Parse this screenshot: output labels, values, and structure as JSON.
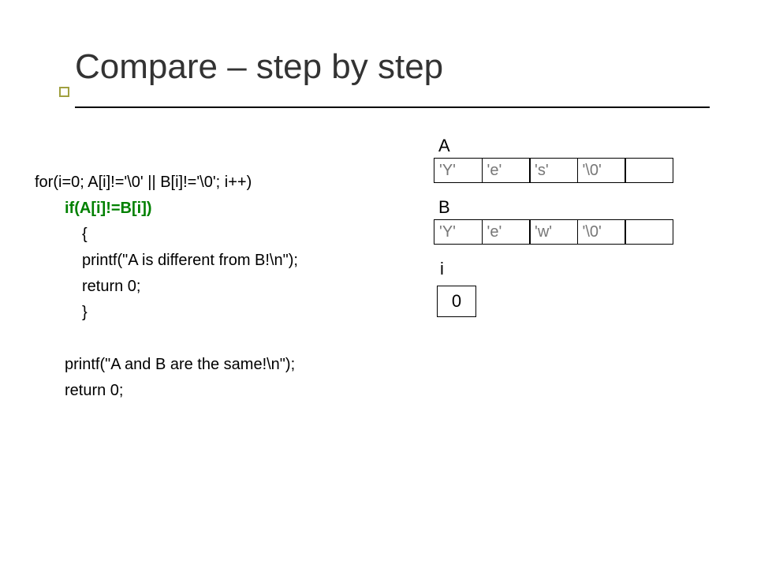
{
  "title": "Compare – step by step",
  "code": {
    "l1": "for(i=0; A[i]!='\\0' || B[i]!='\\0'; i++)",
    "l2": "if(A[i]!=B[i])",
    "l3": "{",
    "l4": "printf(\"A is different from B!\\n\");",
    "l5": "return 0;",
    "l6": "}",
    "l7": "printf(\"A and B are the same!\\n\");",
    "l8": "return 0;"
  },
  "arrays": {
    "A": {
      "label": "A",
      "cells": [
        "'Y'",
        "'e'",
        "'s'",
        "'\\0'",
        ""
      ]
    },
    "B": {
      "label": "B",
      "cells": [
        "'Y'",
        "'e'",
        "'w'",
        "'\\0'",
        ""
      ]
    }
  },
  "i": {
    "label": "i",
    "value": "0"
  }
}
